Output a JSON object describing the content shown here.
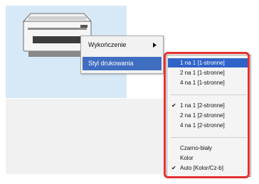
{
  "context_menu": {
    "finish_label": "Wykończenie",
    "style_label": "Styl drukowania"
  },
  "submenu": {
    "items": [
      {
        "label": "1 na 1 [1-stronne]",
        "checked": false,
        "highlighted": true
      },
      {
        "label": "2 na 1 [1-stronne]",
        "checked": false
      },
      {
        "label": "4 na 1 [1-stronne]",
        "checked": false
      },
      {
        "label": "1 na 1 [2-stronne]",
        "checked": true
      },
      {
        "label": "2 na 1 [2-stronne]",
        "checked": false
      },
      {
        "label": "4 na 1 [2-stronne]",
        "checked": false
      },
      {
        "label": "Czarno-biały",
        "checked": false
      },
      {
        "label": "Kolor",
        "checked": false
      },
      {
        "label": "Auto [Kolor/Cz-b]",
        "checked": true
      }
    ]
  },
  "colors": {
    "highlight": "#2f63c7",
    "outline": "#e43131",
    "panel_bg": "#d7e9f6"
  },
  "icons": {
    "submenu_arrow": "triangle-right-icon",
    "check": "check-icon"
  }
}
